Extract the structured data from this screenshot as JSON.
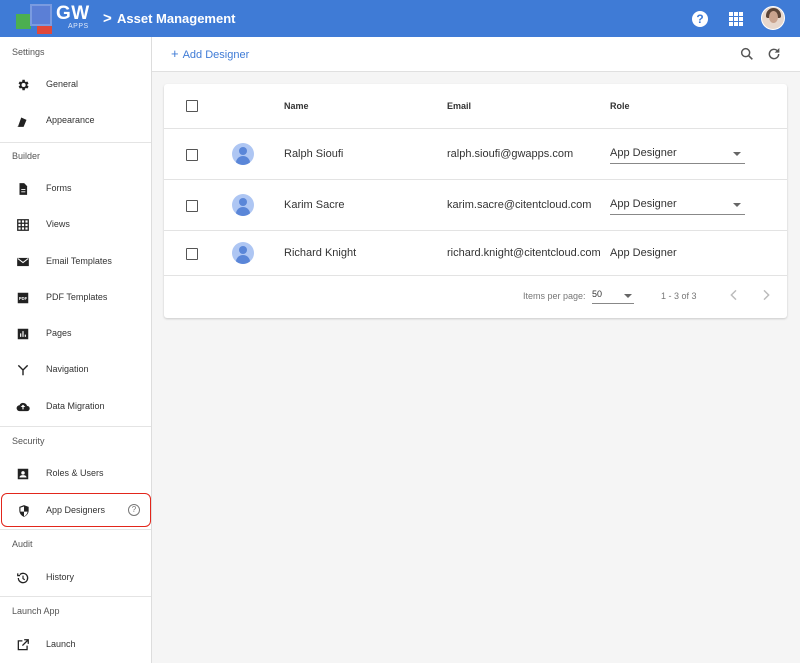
{
  "header": {
    "logo_text": "GW",
    "logo_sub": "APPS",
    "breadcrumb_chevron": ">",
    "title": "Asset Management",
    "help_icon": "?",
    "icons": {
      "help": "help-icon",
      "apps": "apps-grid-icon",
      "avatar": "user-avatar"
    }
  },
  "sidebar": {
    "sections": [
      {
        "label": "Settings",
        "items": [
          {
            "label": "General",
            "icon": "gear-icon"
          },
          {
            "label": "Appearance",
            "icon": "paint-bucket-icon"
          }
        ]
      },
      {
        "label": "Builder",
        "items": [
          {
            "label": "Forms",
            "icon": "document-icon"
          },
          {
            "label": "Views",
            "icon": "table-grid-icon"
          },
          {
            "label": "Email Templates",
            "icon": "envelope-icon"
          },
          {
            "label": "PDF Templates",
            "icon": "pdf-icon"
          },
          {
            "label": "Pages",
            "icon": "bar-chart-icon"
          },
          {
            "label": "Navigation",
            "icon": "fork-icon"
          },
          {
            "label": "Data Migration",
            "icon": "cloud-upload-icon"
          }
        ]
      },
      {
        "label": "Security",
        "items": [
          {
            "label": "Roles & Users",
            "icon": "contact-card-icon"
          },
          {
            "label": "App Designers",
            "icon": "shield-icon",
            "selected": true,
            "help": "?"
          }
        ]
      },
      {
        "label": "Audit",
        "items": [
          {
            "label": "History",
            "icon": "history-icon"
          }
        ]
      },
      {
        "label": "Launch App",
        "items": [
          {
            "label": "Launch",
            "icon": "open-external-icon"
          }
        ]
      }
    ]
  },
  "toolbar": {
    "add_plus": "+",
    "add_label": "Add Designer",
    "icons": {
      "search": "search-icon",
      "refresh": "refresh-icon"
    }
  },
  "table": {
    "columns": {
      "name": "Name",
      "email": "Email",
      "role": "Role"
    },
    "rows": [
      {
        "name": "Ralph Sioufi",
        "email": "ralph.sioufi@gwapps.com",
        "role": "App Designer",
        "role_editable": true
      },
      {
        "name": "Karim Sacre",
        "email": "karim.sacre@citentcloud.com",
        "role": "App Designer",
        "role_editable": true
      },
      {
        "name": "Richard Knight",
        "email": "richard.knight@citentcloud.com",
        "role": "App Designer",
        "role_editable": false
      }
    ],
    "paginator": {
      "items_per_page_label": "Items per page:",
      "items_per_page_value": "50",
      "range_label": "1 - 3 of 3"
    }
  },
  "colors": {
    "header_bg": "#3f7bd6",
    "accent": "#3f7bd6",
    "selection_outline": "#e2261b"
  }
}
